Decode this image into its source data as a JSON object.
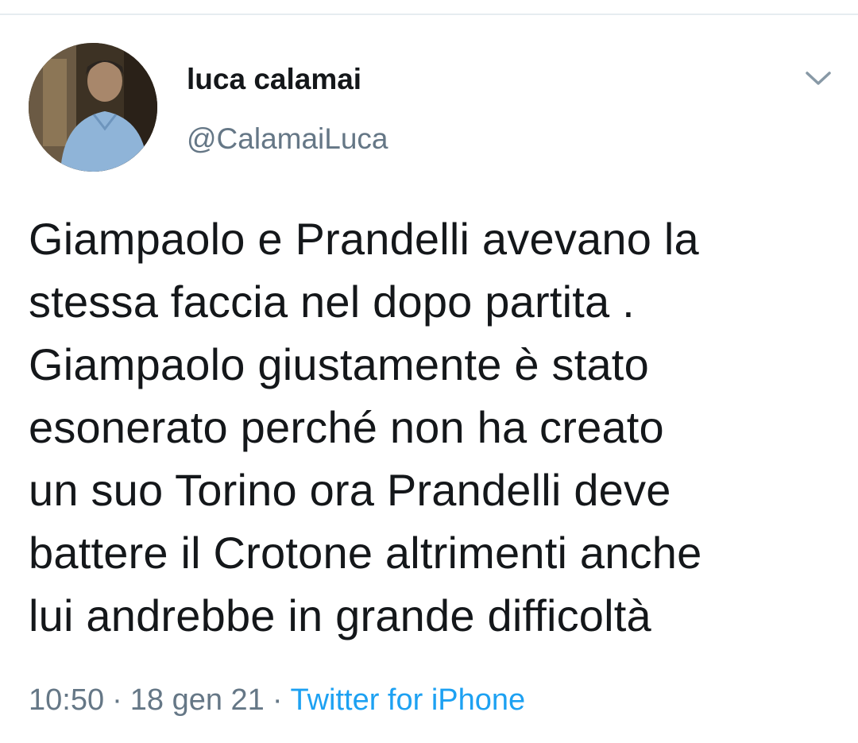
{
  "tweet": {
    "author": {
      "display_name": "luca calamai",
      "handle": "@CalamaiLuca"
    },
    "text": "Giampaolo e Prandelli avevano la\nstessa faccia nel dopo partita .\nGiampaolo giustamente è stato\nesonerato perché non ha creato\nun suo Torino ora Prandelli deve\nbattere il Crotone altrimenti anche\nlui andrebbe in grande difficoltà",
    "time": "10:50",
    "separator": "·",
    "date": "18 gen 21",
    "source": "Twitter for iPhone"
  },
  "icons": {
    "menu": "chevron-down-icon"
  },
  "colors": {
    "text": "#14171a",
    "secondary_text": "#657786",
    "link": "#1da1f2",
    "divider": "#e6ecf0"
  }
}
